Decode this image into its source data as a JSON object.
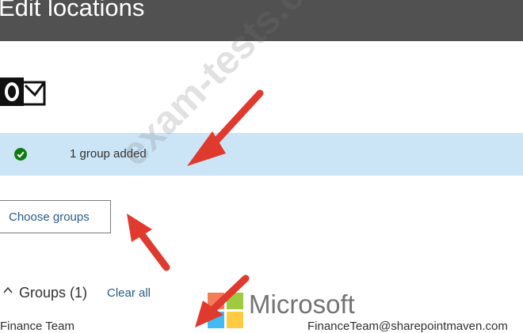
{
  "header": {
    "title": "Edit locations"
  },
  "logo": {
    "icon": "outlook-icon"
  },
  "banner": {
    "icon": "check-circle-icon",
    "text": "1 group added",
    "bg_color": "#cce5f6",
    "icon_color": "#107c10"
  },
  "actions": {
    "choose_groups_label": "Choose groups"
  },
  "groups": {
    "header_label": "Groups (1)",
    "clear_all_label": "Clear all",
    "rows": [
      {
        "name": "Finance Team",
        "email": "FinanceTeam@sharepointmaven.com"
      }
    ]
  },
  "overlay": {
    "watermark": "exam-tests.com",
    "brand": "Microsoft",
    "arrow_color": "#e03a2e"
  }
}
